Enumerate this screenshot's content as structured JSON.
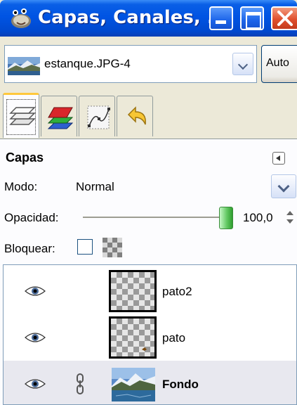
{
  "window": {
    "title": "Capas, Canales, ..."
  },
  "image_selector": {
    "label": "estanque.JPG-4",
    "auto_button": "Auto"
  },
  "tabs": [
    {
      "name": "layers",
      "icon": "layers-icon",
      "active": true
    },
    {
      "name": "channels",
      "icon": "channels-icon",
      "active": false
    },
    {
      "name": "paths",
      "icon": "paths-icon",
      "active": false
    },
    {
      "name": "undo-history",
      "icon": "undo-history-icon",
      "active": false
    }
  ],
  "panel": {
    "title": "Capas",
    "mode_label": "Modo:",
    "mode_value": "Normal",
    "opacity_label": "Opacidad:",
    "opacity_value": "100,0",
    "lock_label": "Bloquear:"
  },
  "layers": [
    {
      "name": "pato2",
      "visible": true,
      "linked": false,
      "selected": false
    },
    {
      "name": "pato",
      "visible": true,
      "linked": false,
      "selected": false
    },
    {
      "name": "Fondo",
      "visible": true,
      "linked": true,
      "selected": true
    }
  ],
  "colors": {
    "titlebar_blue": "#0054e3",
    "close_red": "#e0502e",
    "slider_green": "#64c964",
    "selection_bg": "#e8e8ef"
  }
}
